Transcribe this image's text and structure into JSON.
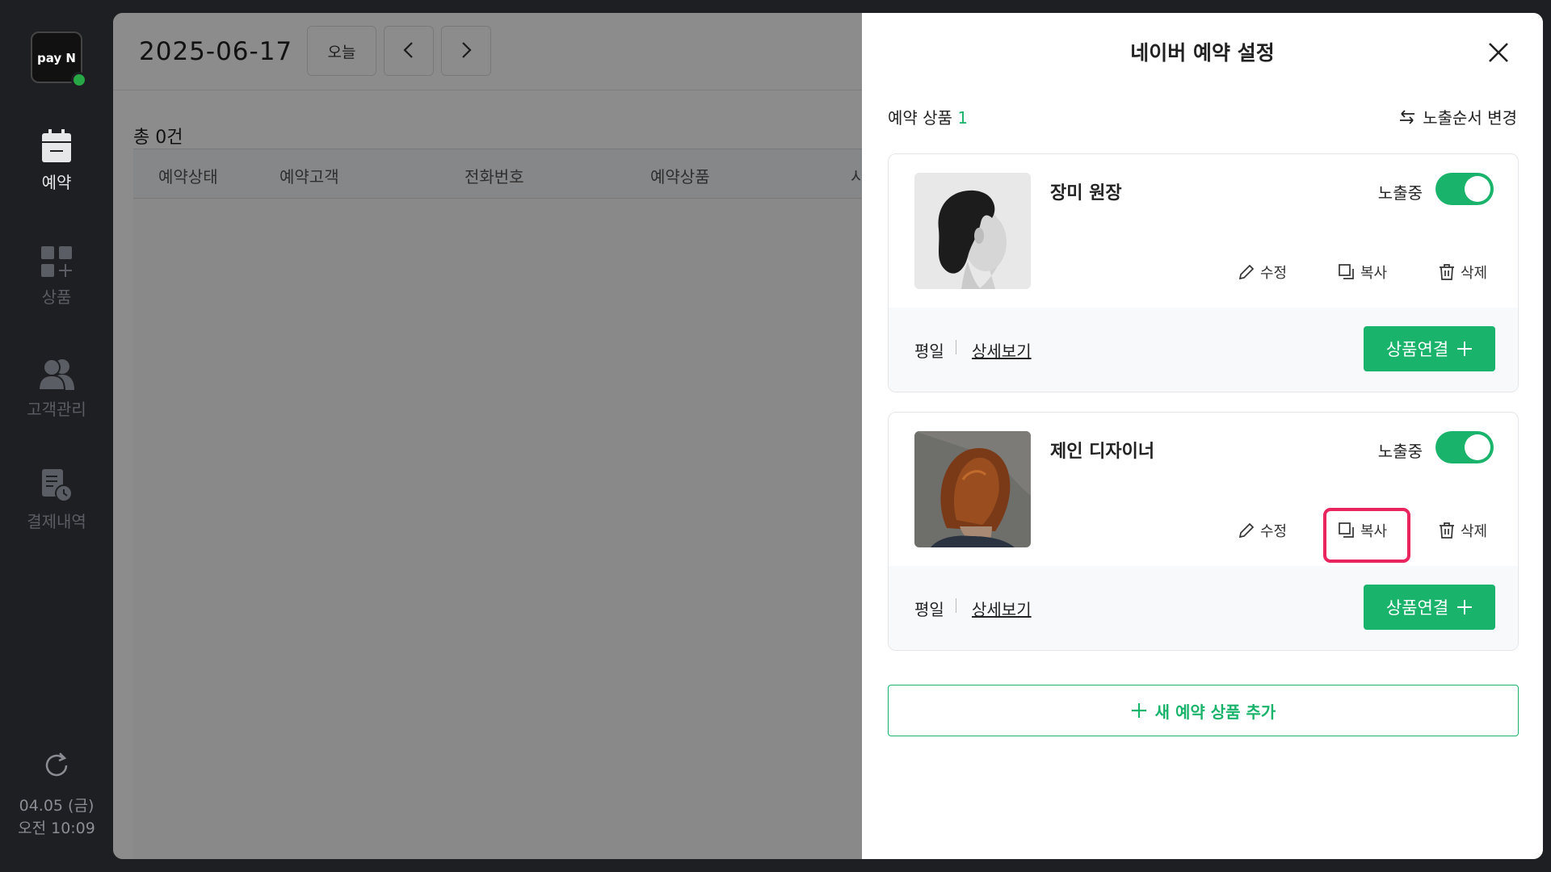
{
  "sidebar": {
    "logo": "pay N",
    "items": [
      {
        "label": "예약",
        "icon": "calendar-icon"
      },
      {
        "label": "상품",
        "icon": "grid-plus-icon"
      },
      {
        "label": "고객관리",
        "icon": "users-icon"
      },
      {
        "label": "결제내역",
        "icon": "receipt-clock-icon"
      }
    ],
    "sync_icon": "refresh-icon",
    "date": "04.05 (금)",
    "time": "오전 10:09"
  },
  "topbar": {
    "date": "2025-06-17",
    "today_label": "오늘"
  },
  "list": {
    "total": "총 0건",
    "columns": [
      "예약상태",
      "예약고객",
      "전화번호",
      "예약상품",
      "시"
    ]
  },
  "panel": {
    "title": "네이버 예약 설정",
    "section_label": "예약 상품",
    "section_count": "1",
    "reorder_label": "노출순서 변경",
    "cards": [
      {
        "name": "장미 원장",
        "visibility_label": "노출중",
        "visible": true,
        "edit_label": "수정",
        "copy_label": "복사",
        "delete_label": "삭제",
        "day_label": "평일",
        "detail_link": "상세보기",
        "link_button": "상품연결"
      },
      {
        "name": "제인 디자이너",
        "visibility_label": "노출중",
        "visible": true,
        "edit_label": "수정",
        "copy_label": "복사",
        "delete_label": "삭제",
        "day_label": "평일",
        "detail_link": "상세보기",
        "link_button": "상품연결"
      }
    ],
    "add_button": "새 예약 상품 추가"
  },
  "colors": {
    "accent": "#1ab36b",
    "highlight": "#e8255e",
    "sidebar_bg": "#1e1f22"
  }
}
